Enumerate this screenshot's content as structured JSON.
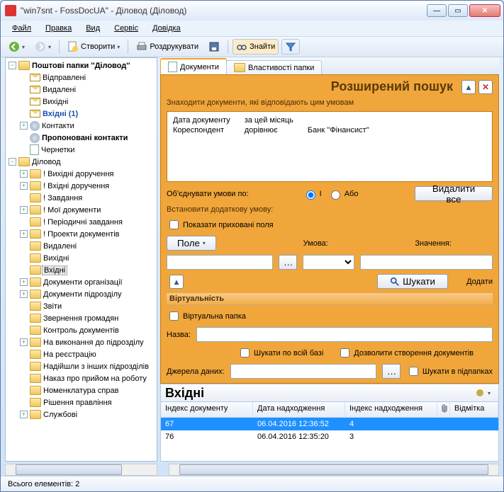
{
  "title": "\"win7snt - FossDocUA\" - Діловод (Діловод)",
  "menu": {
    "file": "Файл",
    "edit": "Правка",
    "view": "Вид",
    "service": "Сервіс",
    "help": "Довідка"
  },
  "toolbar": {
    "create": "Створити",
    "print": "Роздрукувати",
    "find": "Знайти"
  },
  "tree": {
    "root1": "Поштові папки ''Діловод''",
    "sent": "Відправлені",
    "deleted": "Видалені",
    "outgoing": "Вихідні",
    "incoming": "Вхідні  (1)",
    "contacts": "Контакти",
    "proposed": "Пропоновані контакти",
    "drafts": "Чернетки",
    "root2": "Діловод",
    "items": [
      "! Вихідні доручення",
      "! Вхідні доручення",
      "! Завдання",
      "! Мої документи",
      "! Періодичні завдання",
      "! Проекти документів",
      "Видалені",
      "Вихідні",
      "Вхідні",
      "Документи організації",
      "Документи підрозділу",
      "Звіти",
      "Звернення громадян",
      "Контроль документів",
      "На виконання до підрозділу",
      "На реєстрацію",
      "Надійшли з інших підрозділів",
      "Наказ про прийом на роботу",
      "Номенклатура справ",
      "Рішення правління",
      "Службові"
    ]
  },
  "tabs": {
    "documents": "Документи",
    "props": "Властивості папки"
  },
  "search": {
    "title": "Розширений пошук",
    "sub": "Знаходити документи, які відповідають цим умовам",
    "cond": {
      "r1c1": "Дата документу",
      "r1c2": "за цей місяць",
      "r1c3": "",
      "r2c1": "Кореспондент",
      "r2c2": "дорівнює",
      "r2c3": "Банк ''Фінансист''"
    },
    "combine_label": "Об'єднувати умови по:",
    "r_and": "І",
    "r_or": "Або",
    "delete_all": "Видалити все",
    "extra_label": "Встановити додаткову умову:",
    "show_hidden": "Показати приховані поля",
    "field_label": "Поле",
    "cond_label": "Умова:",
    "value_label": "Значення:",
    "search_btn": "Шукати",
    "add_btn": "Додати",
    "virt_section": "Віртуальність",
    "virt_folder": "Віртуальна папка",
    "name_label": "Назва:",
    "search_all": "Шукати по всій базі",
    "allow_create": "Дозволити створення документів",
    "sources_label": "Джерела даних:",
    "search_sub": "Шукати в підпапках"
  },
  "grid": {
    "title": "Вхідні",
    "cols": {
      "c1": "Індекс документу",
      "c2": "Дата надходження",
      "c3": "Індекс надходження",
      "c4": "Відмітка"
    },
    "rows": [
      {
        "c1": "67",
        "c2": "06.04.2016 12:36:52",
        "c3": "4"
      },
      {
        "c1": "76",
        "c2": "06.04.2016 12:35:20",
        "c3": "3"
      }
    ]
  },
  "status": "Всього елементів: 2"
}
